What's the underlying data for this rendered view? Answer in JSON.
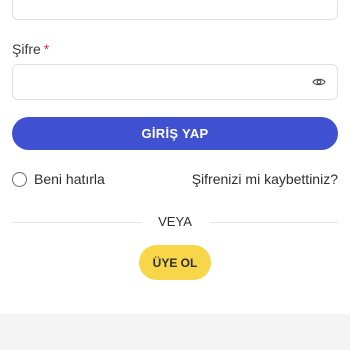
{
  "password": {
    "label": "Şifre",
    "required_mark": "*",
    "value": "",
    "icon": "eye-icon"
  },
  "login_button": {
    "label": "GİRİŞ YAP",
    "color": "#3f51d0"
  },
  "remember_me": {
    "label": "Beni hatırla",
    "checked": false
  },
  "forgot_password": {
    "label": "Şifrenizi mi kaybettiniz?"
  },
  "separator": {
    "label": "VEYA"
  },
  "signup_button": {
    "label": "ÜYE OL",
    "color": "#f8d64a"
  }
}
